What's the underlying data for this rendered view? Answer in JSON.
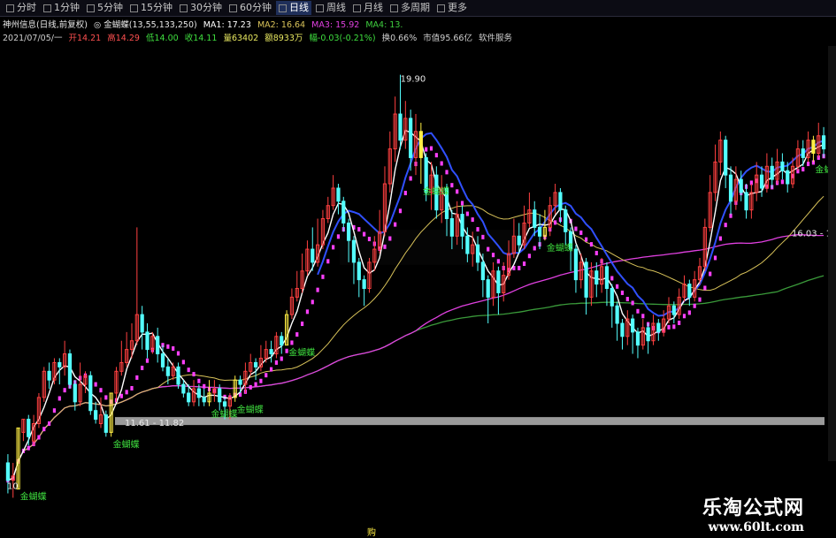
{
  "toolbar": {
    "tabs": [
      {
        "label": "分时",
        "active": false
      },
      {
        "label": "1分钟",
        "active": false
      },
      {
        "label": "5分钟",
        "active": false
      },
      {
        "label": "15分钟",
        "active": false
      },
      {
        "label": "30分钟",
        "active": false
      },
      {
        "label": "60分钟",
        "active": false
      },
      {
        "label": "日线",
        "active": true
      },
      {
        "label": "周线",
        "active": false
      },
      {
        "label": "月线",
        "active": false
      },
      {
        "label": "多周期",
        "active": false
      },
      {
        "label": "更多",
        "active": false
      }
    ]
  },
  "info1": {
    "stock": "神州信息(日线,前复权)",
    "indicator": "◎ 金蝴蝶(13,55,133,250)",
    "ma1": "MA1: 17.23",
    "ma2": "MA2: 16.64",
    "ma3": "MA3: 15.92",
    "ma4": "MA4: 13."
  },
  "info2": {
    "date": "2021/07/05/一",
    "open": "开14.21",
    "high": "高14.29",
    "low": "低14.00",
    "close": "收14.11",
    "volume": "量63402",
    "amount": "额8933万",
    "change": "幅-0.03(-0.21%)",
    "turnover": "换0.66%",
    "market_cap": "市值95.66亿",
    "software": "软件服务"
  },
  "colors": {
    "up": "#ff4040",
    "down": "#54ffff",
    "signal": "#ffee44",
    "ma1": "#ffffff",
    "ma2": "#d9c35a",
    "ma3": "#e040e0",
    "ma4": "#3a9a3a",
    "butterfly": "#ff40ff",
    "blue": "#3050ff"
  },
  "annotations": {
    "high_label": "19.90",
    "low_label": "11.61 - 11.82",
    "low2_label": "10",
    "right_label": "16.03 - 16",
    "signal_label": "金蝴蝶",
    "bottom_char": "购"
  },
  "signals": [
    2,
    20,
    39,
    44,
    54,
    80,
    104,
    156
  ],
  "watermark": {
    "cn": "乐淘公式网",
    "url": "www.60lt.com"
  },
  "chart_data": {
    "type": "candlestick",
    "title": "神州信息(日线,前复权)",
    "ylim": [
      9.5,
      20.5
    ],
    "candles": [
      [
        11.0,
        10.6,
        11.2,
        10.3
      ],
      [
        10.6,
        10.7,
        11.0,
        10.2
      ],
      [
        10.4,
        11.8,
        11.8,
        10.4
      ],
      [
        11.7,
        12.0,
        12.0,
        11.5
      ],
      [
        12.0,
        11.6,
        12.1,
        11.4
      ],
      [
        11.5,
        11.9,
        12.1,
        11.4
      ],
      [
        11.9,
        12.5,
        12.6,
        11.8
      ],
      [
        12.5,
        13.1,
        13.2,
        12.4
      ],
      [
        13.1,
        12.9,
        13.3,
        12.7
      ],
      [
        12.9,
        13.3,
        13.4,
        12.8
      ],
      [
        13.3,
        13.2,
        13.4,
        12.8
      ],
      [
        13.2,
        13.5,
        13.8,
        13.0
      ],
      [
        13.5,
        12.8,
        13.6,
        12.7
      ],
      [
        12.8,
        12.4,
        12.9,
        12.2
      ],
      [
        12.4,
        12.8,
        13.3,
        12.3
      ],
      [
        12.8,
        13.0,
        13.1,
        12.6
      ],
      [
        13.0,
        12.2,
        13.1,
        12.1
      ],
      [
        12.2,
        12.0,
        12.4,
        11.9
      ],
      [
        11.9,
        12.1,
        12.5,
        11.8
      ],
      [
        12.1,
        11.7,
        12.2,
        11.6
      ],
      [
        11.7,
        12.6,
        12.6,
        11.6
      ],
      [
        12.6,
        13.1,
        13.2,
        12.4
      ],
      [
        13.1,
        13.3,
        13.8,
        13.0
      ],
      [
        13.3,
        13.6,
        14.0,
        13.2
      ],
      [
        13.6,
        13.8,
        14.2,
        13.4
      ],
      [
        13.8,
        14.4,
        16.4,
        13.7
      ],
      [
        14.4,
        14.0,
        14.6,
        13.6
      ],
      [
        14.0,
        13.6,
        14.2,
        13.4
      ],
      [
        13.6,
        13.9,
        14.0,
        13.5
      ],
      [
        13.9,
        13.5,
        14.1,
        13.3
      ],
      [
        13.5,
        13.2,
        13.7,
        13.1
      ],
      [
        13.2,
        13.0,
        13.4,
        12.8
      ],
      [
        13.0,
        13.2,
        13.3,
        12.9
      ],
      [
        13.2,
        12.8,
        13.3,
        12.7
      ],
      [
        12.8,
        12.6,
        12.9,
        12.5
      ],
      [
        12.6,
        12.4,
        12.8,
        12.3
      ],
      [
        12.4,
        12.7,
        12.9,
        12.3
      ],
      [
        12.7,
        12.5,
        12.8,
        12.3
      ],
      [
        12.5,
        12.4,
        12.7,
        12.3
      ],
      [
        12.4,
        12.6,
        12.9,
        12.3
      ],
      [
        12.6,
        12.7,
        12.9,
        12.4
      ],
      [
        12.7,
        12.4,
        12.8,
        12.2
      ],
      [
        12.4,
        12.3,
        12.5,
        12.0
      ],
      [
        12.3,
        12.5,
        12.6,
        12.0
      ],
      [
        12.5,
        12.9,
        13.0,
        12.4
      ],
      [
        12.9,
        12.8,
        13.0,
        12.6
      ],
      [
        12.8,
        13.1,
        13.3,
        12.6
      ],
      [
        13.1,
        13.3,
        13.5,
        13.0
      ],
      [
        13.3,
        13.2,
        13.4,
        12.9
      ],
      [
        13.2,
        13.4,
        13.7,
        13.1
      ],
      [
        13.4,
        13.6,
        13.8,
        13.3
      ],
      [
        13.6,
        13.5,
        13.8,
        13.3
      ],
      [
        13.5,
        13.9,
        14.0,
        13.4
      ],
      [
        13.9,
        13.7,
        14.0,
        13.5
      ],
      [
        13.7,
        14.4,
        14.5,
        13.7
      ],
      [
        14.4,
        14.8,
        15.0,
        14.3
      ],
      [
        14.8,
        15.0,
        15.4,
        14.7
      ],
      [
        15.0,
        15.4,
        15.8,
        14.9
      ],
      [
        15.4,
        15.9,
        16.1,
        15.3
      ],
      [
        15.9,
        15.6,
        16.4,
        15.4
      ],
      [
        15.6,
        16.0,
        16.6,
        15.5
      ],
      [
        16.0,
        16.6,
        16.8,
        15.9
      ],
      [
        16.6,
        16.9,
        17.1,
        16.5
      ],
      [
        16.9,
        17.3,
        17.6,
        16.8
      ],
      [
        17.3,
        17.0,
        17.4,
        16.7
      ],
      [
        17.0,
        16.5,
        17.1,
        16.3
      ],
      [
        16.5,
        16.1,
        16.6,
        15.6
      ],
      [
        16.1,
        15.6,
        16.2,
        15.1
      ],
      [
        15.6,
        15.2,
        15.7,
        14.8
      ],
      [
        15.2,
        15.0,
        15.3,
        14.6
      ],
      [
        15.0,
        15.6,
        15.7,
        14.9
      ],
      [
        15.6,
        15.9,
        16.2,
        15.4
      ],
      [
        15.9,
        16.3,
        16.8,
        15.8
      ],
      [
        16.3,
        17.4,
        17.8,
        16.2
      ],
      [
        17.4,
        18.2,
        18.6,
        17.2
      ],
      [
        18.2,
        19.0,
        19.4,
        17.9
      ],
      [
        19.0,
        18.4,
        19.9,
        18.2
      ],
      [
        18.4,
        18.9,
        19.3,
        18.2
      ],
      [
        18.9,
        18.0,
        19.1,
        17.7
      ],
      [
        18.0,
        18.6,
        19.0,
        17.6
      ],
      [
        18.6,
        18.0,
        18.8,
        17.4
      ],
      [
        18.0,
        17.2,
        18.1,
        17.0
      ],
      [
        17.2,
        17.6,
        17.9,
        16.8
      ],
      [
        17.6,
        16.8,
        17.8,
        16.6
      ],
      [
        16.8,
        17.3,
        17.6,
        16.5
      ],
      [
        17.3,
        16.6,
        17.4,
        16.2
      ],
      [
        16.6,
        16.2,
        16.8,
        15.9
      ],
      [
        16.2,
        16.7,
        17.0,
        16.0
      ],
      [
        16.7,
        16.2,
        16.9,
        15.9
      ],
      [
        16.2,
        15.8,
        16.4,
        15.6
      ],
      [
        15.8,
        16.0,
        16.3,
        15.5
      ],
      [
        16.0,
        15.6,
        16.2,
        15.4
      ],
      [
        15.6,
        15.2,
        15.8,
        14.8
      ],
      [
        15.2,
        14.8,
        15.3,
        14.2
      ],
      [
        14.8,
        15.4,
        15.6,
        14.6
      ],
      [
        15.4,
        14.9,
        15.5,
        14.4
      ],
      [
        14.9,
        15.3,
        15.6,
        14.7
      ],
      [
        15.3,
        15.8,
        16.1,
        15.2
      ],
      [
        15.8,
        16.2,
        16.6,
        15.7
      ],
      [
        16.2,
        16.0,
        16.5,
        15.8
      ],
      [
        16.0,
        16.5,
        16.9,
        15.9
      ],
      [
        16.5,
        16.8,
        17.2,
        16.4
      ],
      [
        16.8,
        16.4,
        17.0,
        16.2
      ],
      [
        16.4,
        16.2,
        16.7,
        15.9
      ],
      [
        16.2,
        16.4,
        16.8,
        16.1
      ],
      [
        16.4,
        16.9,
        17.1,
        16.2
      ],
      [
        16.9,
        17.2,
        17.4,
        16.7
      ],
      [
        17.2,
        16.8,
        17.3,
        16.5
      ],
      [
        16.8,
        16.3,
        16.9,
        16.0
      ],
      [
        16.3,
        15.9,
        16.4,
        15.4
      ],
      [
        15.9,
        15.2,
        16.0,
        14.9
      ],
      [
        15.2,
        15.6,
        15.8,
        15.0
      ],
      [
        15.6,
        14.8,
        15.7,
        14.4
      ],
      [
        14.8,
        15.4,
        15.6,
        14.6
      ],
      [
        15.4,
        15.1,
        15.6,
        14.8
      ],
      [
        15.1,
        15.5,
        15.7,
        14.9
      ],
      [
        15.5,
        15.0,
        15.6,
        14.6
      ],
      [
        15.0,
        14.6,
        15.1,
        14.1
      ],
      [
        14.6,
        14.2,
        14.7,
        13.8
      ],
      [
        14.2,
        13.9,
        14.3,
        13.6
      ],
      [
        13.9,
        14.3,
        14.5,
        13.7
      ],
      [
        14.3,
        14.0,
        14.4,
        13.5
      ],
      [
        14.0,
        13.7,
        14.1,
        13.4
      ],
      [
        13.7,
        14.1,
        14.3,
        13.6
      ],
      [
        14.1,
        13.8,
        14.2,
        13.5
      ],
      [
        13.8,
        14.2,
        14.4,
        13.7
      ],
      [
        14.2,
        14.0,
        14.3,
        13.8
      ],
      [
        14.0,
        14.3,
        14.5,
        13.9
      ],
      [
        14.3,
        14.6,
        14.8,
        14.2
      ],
      [
        14.6,
        14.4,
        14.7,
        14.2
      ],
      [
        14.4,
        14.8,
        15.0,
        14.3
      ],
      [
        14.8,
        15.1,
        15.3,
        14.7
      ],
      [
        15.1,
        14.8,
        15.2,
        14.6
      ],
      [
        14.8,
        15.2,
        15.4,
        14.7
      ],
      [
        15.2,
        15.5,
        15.7,
        15.1
      ],
      [
        15.5,
        16.4,
        16.6,
        15.4
      ],
      [
        16.4,
        17.2,
        17.6,
        16.3
      ],
      [
        17.2,
        17.9,
        18.3,
        17.0
      ],
      [
        17.9,
        18.4,
        18.6,
        17.6
      ],
      [
        18.4,
        17.6,
        18.5,
        17.3
      ],
      [
        17.6,
        17.0,
        17.8,
        16.7
      ],
      [
        17.0,
        17.5,
        17.8,
        16.8
      ],
      [
        17.5,
        17.2,
        17.7,
        17.0
      ],
      [
        17.2,
        16.8,
        17.4,
        16.6
      ],
      [
        16.8,
        17.2,
        17.4,
        16.6
      ],
      [
        17.2,
        17.6,
        17.9,
        17.0
      ],
      [
        17.6,
        17.3,
        17.8,
        17.1
      ],
      [
        17.3,
        17.8,
        18.1,
        17.2
      ],
      [
        17.8,
        17.5,
        18.0,
        17.3
      ],
      [
        17.5,
        17.9,
        18.2,
        17.4
      ],
      [
        17.9,
        17.7,
        18.1,
        17.5
      ],
      [
        17.7,
        17.4,
        17.9,
        17.2
      ],
      [
        17.4,
        17.8,
        18.0,
        17.3
      ],
      [
        17.8,
        18.2,
        18.4,
        17.7
      ],
      [
        18.2,
        18.0,
        18.4,
        17.8
      ],
      [
        18.0,
        18.4,
        18.6,
        17.9
      ],
      [
        18.4,
        18.1,
        18.5,
        17.9
      ],
      [
        18.1,
        18.5,
        18.8,
        18.0
      ],
      [
        18.5,
        18.2,
        18.7,
        18.0
      ]
    ]
  }
}
